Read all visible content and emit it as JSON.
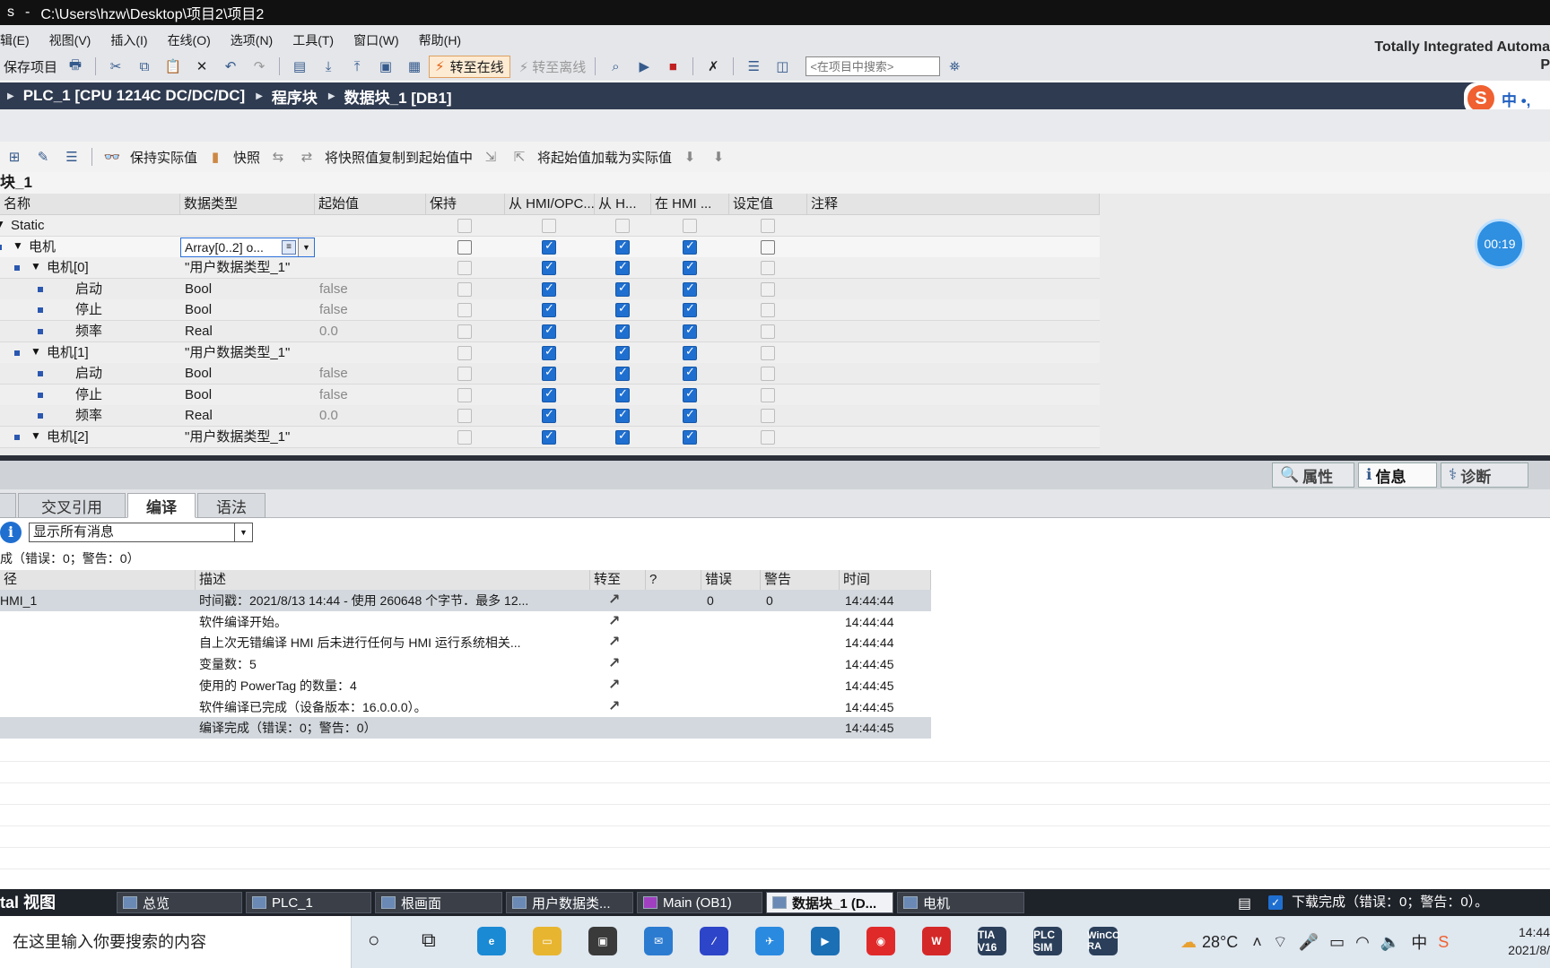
{
  "titlebar": {
    "prefix": "s",
    "path": "C:\\Users\\hzw\\Desktop\\项目2\\项目2"
  },
  "menu": [
    "辑(E)",
    "视图(V)",
    "插入(I)",
    "在线(O)",
    "选项(N)",
    "工具(T)",
    "窗口(W)",
    "帮助(H)"
  ],
  "brand": {
    "line1": "Totally Integrated Automa",
    "line2": "P"
  },
  "toolbar": {
    "save_project": "保存项目",
    "go_online": "转至在线",
    "go_offline": "转至离线",
    "search_placeholder": "<在项目中搜索>"
  },
  "breadcrumb": [
    "PLC_1 [CPU 1214C DC/DC/DC]",
    "程序块",
    "数据块_1 [DB1]"
  ],
  "ime": {
    "logo": "S",
    "mode": "中 •,"
  },
  "db_toolbar": {
    "keep_actual": "保持实际值",
    "snapshot": "快照",
    "copy_snapshot": "将快照值复制到起始值中",
    "load_start": "将起始值加载为实际值"
  },
  "db_title": "块_1",
  "table": {
    "headers": [
      "名称",
      "数据类型",
      "起始值",
      "保持",
      "从 HMI/OPC...",
      "从 H...",
      "在 HMI ...",
      "设定值",
      "注释"
    ],
    "rows": [
      {
        "indent": 0,
        "name": "Static",
        "type": "",
        "start": "",
        "kind": "section",
        "cbs": [
          0,
          0,
          0,
          0,
          0
        ],
        "dim": true
      },
      {
        "indent": 1,
        "name": "电机",
        "type": "Array[0..2] o...",
        "start": "",
        "kind": "array",
        "cbs": [
          0,
          1,
          1,
          1,
          0
        ],
        "dim": false
      },
      {
        "indent": 2,
        "name": "电机[0]",
        "type": "\"用户数据类型_1\"",
        "start": "",
        "kind": "struct",
        "cbs": [
          0,
          1,
          1,
          1,
          0
        ],
        "dim": true
      },
      {
        "indent": 3,
        "name": "启动",
        "type": "Bool",
        "start": "false",
        "kind": "leaf",
        "cbs": [
          0,
          1,
          1,
          1,
          0
        ],
        "dim": true
      },
      {
        "indent": 3,
        "name": "停止",
        "type": "Bool",
        "start": "false",
        "kind": "leaf",
        "cbs": [
          0,
          1,
          1,
          1,
          0
        ],
        "dim": true
      },
      {
        "indent": 3,
        "name": "频率",
        "type": "Real",
        "start": "0.0",
        "kind": "leaf",
        "cbs": [
          0,
          1,
          1,
          1,
          0
        ],
        "dim": true
      },
      {
        "indent": 2,
        "name": "电机[1]",
        "type": "\"用户数据类型_1\"",
        "start": "",
        "kind": "struct",
        "cbs": [
          0,
          1,
          1,
          1,
          0
        ],
        "dim": true
      },
      {
        "indent": 3,
        "name": "启动",
        "type": "Bool",
        "start": "false",
        "kind": "leaf",
        "cbs": [
          0,
          1,
          1,
          1,
          0
        ],
        "dim": true
      },
      {
        "indent": 3,
        "name": "停止",
        "type": "Bool",
        "start": "false",
        "kind": "leaf",
        "cbs": [
          0,
          1,
          1,
          1,
          0
        ],
        "dim": true
      },
      {
        "indent": 3,
        "name": "频率",
        "type": "Real",
        "start": "0.0",
        "kind": "leaf",
        "cbs": [
          0,
          1,
          1,
          1,
          0
        ],
        "dim": true
      },
      {
        "indent": 2,
        "name": "电机[2]",
        "type": "\"用户数据类型_1\"",
        "start": "",
        "kind": "struct",
        "cbs": [
          0,
          1,
          1,
          1,
          0
        ],
        "dim": true
      }
    ]
  },
  "timer": "00:19",
  "inspector": {
    "tabs": [
      "属性",
      "信息",
      "诊断"
    ],
    "active": "信息"
  },
  "panel_tabs": {
    "tabs": [
      "交叉引用",
      "编译",
      "语法"
    ],
    "active": "编译"
  },
  "filter": {
    "value": "显示所有消息"
  },
  "summary": "成（错误：0；警告：0）",
  "messages": {
    "headers": [
      "径",
      "描述",
      "转至",
      "?",
      "错误",
      "警告",
      "时间"
    ],
    "rows": [
      {
        "path": "HMI_1",
        "desc": "时间戳：2021/8/13 14:44 - 使用 260648 个字节．最多 12...",
        "goto": "↗",
        "err": "0",
        "warn": "0",
        "time": "14:44:44"
      },
      {
        "path": "",
        "desc": "软件编译开始。",
        "goto": "↗",
        "err": "",
        "warn": "",
        "time": "14:44:44"
      },
      {
        "path": "",
        "desc": "自上次无错编译 HMI 后未进行任何与 HMI 运行系统相关...",
        "goto": "↗",
        "err": "",
        "warn": "",
        "time": "14:44:44"
      },
      {
        "path": "",
        "desc": "变量数：5",
        "goto": "↗",
        "err": "",
        "warn": "",
        "time": "14:44:45"
      },
      {
        "path": "",
        "desc": "使用的 PowerTag 的数量：4",
        "goto": "↗",
        "err": "",
        "warn": "",
        "time": "14:44:45"
      },
      {
        "path": "",
        "desc": "软件编译已完成（设备版本：16.0.0.0）。",
        "goto": "↗",
        "err": "",
        "warn": "",
        "time": "14:44:45"
      },
      {
        "path": "",
        "desc": "编译完成（错误：0；警告：0）",
        "goto": "",
        "err": "",
        "warn": "",
        "time": "14:44:45"
      }
    ]
  },
  "portal": {
    "view": "tal 视图",
    "tasks": [
      "总览",
      "PLC_1",
      "根画面",
      "用户数据类...",
      "Main (OB1)",
      "数据块_1 (D...",
      "电机"
    ],
    "active": "数据块_1 (D...",
    "download": "下载完成（错误：0；警告：0）。"
  },
  "windows": {
    "search": "在这里输入你要搜索的内容",
    "weather": "28°C",
    "lang": "中",
    "time": "14:44",
    "date": "2021/8/",
    "apps": [
      "TIA V16",
      "PLC SIM",
      "WinCC RA"
    ]
  }
}
